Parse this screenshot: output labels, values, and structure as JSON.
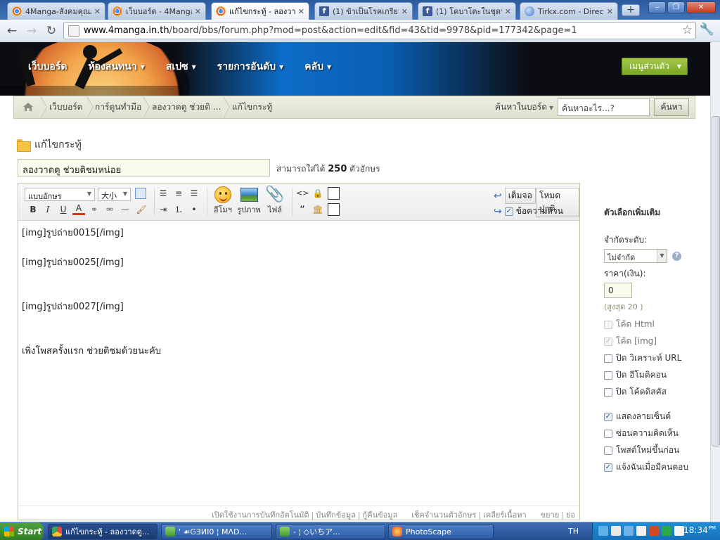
{
  "browser": {
    "tabs": [
      {
        "title": "4Manga-สังคมคุณภา",
        "icon": "chrome-icon",
        "active": false
      },
      {
        "title": "เว็บบอร์ด - 4Manga-",
        "icon": "chrome-icon",
        "active": false
      },
      {
        "title": "แก้ไขกระทู้ - ลองวาด",
        "icon": "chrome-icon",
        "active": true
      },
      {
        "title": "(1) ข้าเป็นโรคเกรียนเ",
        "icon": "facebook-icon",
        "active": false
      },
      {
        "title": "(1) โคบาโตะในชุดนัก",
        "icon": "facebook-icon",
        "active": false
      },
      {
        "title": "Tirkx.com - Direct Ar",
        "icon": "globe-icon",
        "active": false
      }
    ],
    "tab_close": "✕",
    "new_tab": "+",
    "url_host": "www.4manga.in.th",
    "url_path": "/board/bbs/forum.php?mod=post&action=edit&fid=43&tid=9978&pid=177342&page=1"
  },
  "site": {
    "nav": [
      {
        "label": "เว็บบอร์ด",
        "caret": false
      },
      {
        "label": "ห้องสนทนา",
        "caret": true
      },
      {
        "label": "สเปซ",
        "caret": true
      },
      {
        "label": "รายการอันดับ",
        "caret": true
      },
      {
        "label": "คลับ",
        "caret": true
      }
    ],
    "user_menu": "เมนูส่วนตัว",
    "breadcrumbs": [
      "เว็บบอร์ด",
      "การ์ตูนทำมือ",
      "ลองวาดดู ช่วยติ ...",
      "แก้ไขกระทู้"
    ],
    "search_scope": "ค้นหาในบอร์ด",
    "search_placeholder": "ค้นหาอะไร...?",
    "search_button": "ค้นหา"
  },
  "post": {
    "heading": "แก้ไขกระทู้",
    "subject": "ลองวาดดู ช่วยติชมหน่อย",
    "char_prefix": "สามารถใส่ได้",
    "char_limit": "250",
    "char_suffix": "ตัวอักษร",
    "toolbar": {
      "font_select": "แบบอักษร",
      "size_select": "大小",
      "bold": "B",
      "italic": "I",
      "underline": "U",
      "font_color": "A",
      "smiley_label": "อีโมฯ",
      "image_label": "รูปภาพ",
      "attach_label": "ไฟล์",
      "code": "<>",
      "quote": "“",
      "fullscreen": "เต็มจอ",
      "normal_mode": "โหมดปกติ",
      "plain_text": "ข้อความล้วน"
    },
    "body": "[img]รูปถ่าย0015[/img]\n\n[img]รูปถ่าย0025[/img]\n\n\n[img]รูปถ่าย0027[/img]\n\n\nเพิ่งโพสครั้งแรก ช่วยติชมด้วยนะคับ",
    "footer": [
      "เปิดใช้งานการบันทึกอัตโนมัติ",
      "บันทึกข้อมูล",
      "กู้คืนข้อมูล",
      "เช็คจำนวนตัวอักษร",
      "เคลียร์เนื้อหา",
      "ขยาย",
      "ย่อ"
    ]
  },
  "options": {
    "title": "ตัวเลือกเพิ่มเติม",
    "read_perm_label": "จำกัดระดับ:",
    "read_perm_value": "ไม่จำกัด",
    "price_label": "ราคา(เงิน):",
    "price_value": "0",
    "price_hint": "(สูงสุด 20 )",
    "checks_a": [
      {
        "label": "โค้ด Html",
        "checked": false,
        "disabled": true
      },
      {
        "label": "โค้ด [img]",
        "checked": true,
        "disabled": true
      },
      {
        "label": "ปิด วิเคราะห์ URL",
        "checked": false,
        "disabled": false
      },
      {
        "label": "ปิด อีโมติคอน",
        "checked": false,
        "disabled": false
      },
      {
        "label": "ปิด โค้ดดิสคัส",
        "checked": false,
        "disabled": false
      }
    ],
    "checks_b": [
      {
        "label": "แสดงลายเซ็นต์",
        "checked": true,
        "disabled": false
      },
      {
        "label": "ซ่อนความคิดเห็น",
        "checked": false,
        "disabled": false
      },
      {
        "label": "โพสต์ใหม่ขึ้นก่อน",
        "checked": false,
        "disabled": false
      },
      {
        "label": "แจ้งฉันเมื่อมีคนตอบ",
        "checked": true,
        "disabled": false
      }
    ]
  },
  "taskbar": {
    "start": "Start",
    "items": [
      {
        "title": "แก้ไขกระทู้ - ลองวาดดู...",
        "icon": "chrome-icon",
        "active": true
      },
      {
        "title": "' ☙GƎИI0 ¦ MΛD...",
        "icon": "messenger-icon",
        "active": false
      },
      {
        "title": "- ¦ ◇いちア...",
        "icon": "messenger-icon",
        "active": false
      },
      {
        "title": "PhotoScape",
        "icon": "photoscape-icon",
        "active": false
      }
    ],
    "lang": "TH",
    "time": "18:34",
    "ampm": "PM"
  },
  "colors": {
    "accent_green": "#7aa524",
    "breadcrumb_bg": "#e6e8d8",
    "titlebar_blue": "#3f73b9"
  }
}
